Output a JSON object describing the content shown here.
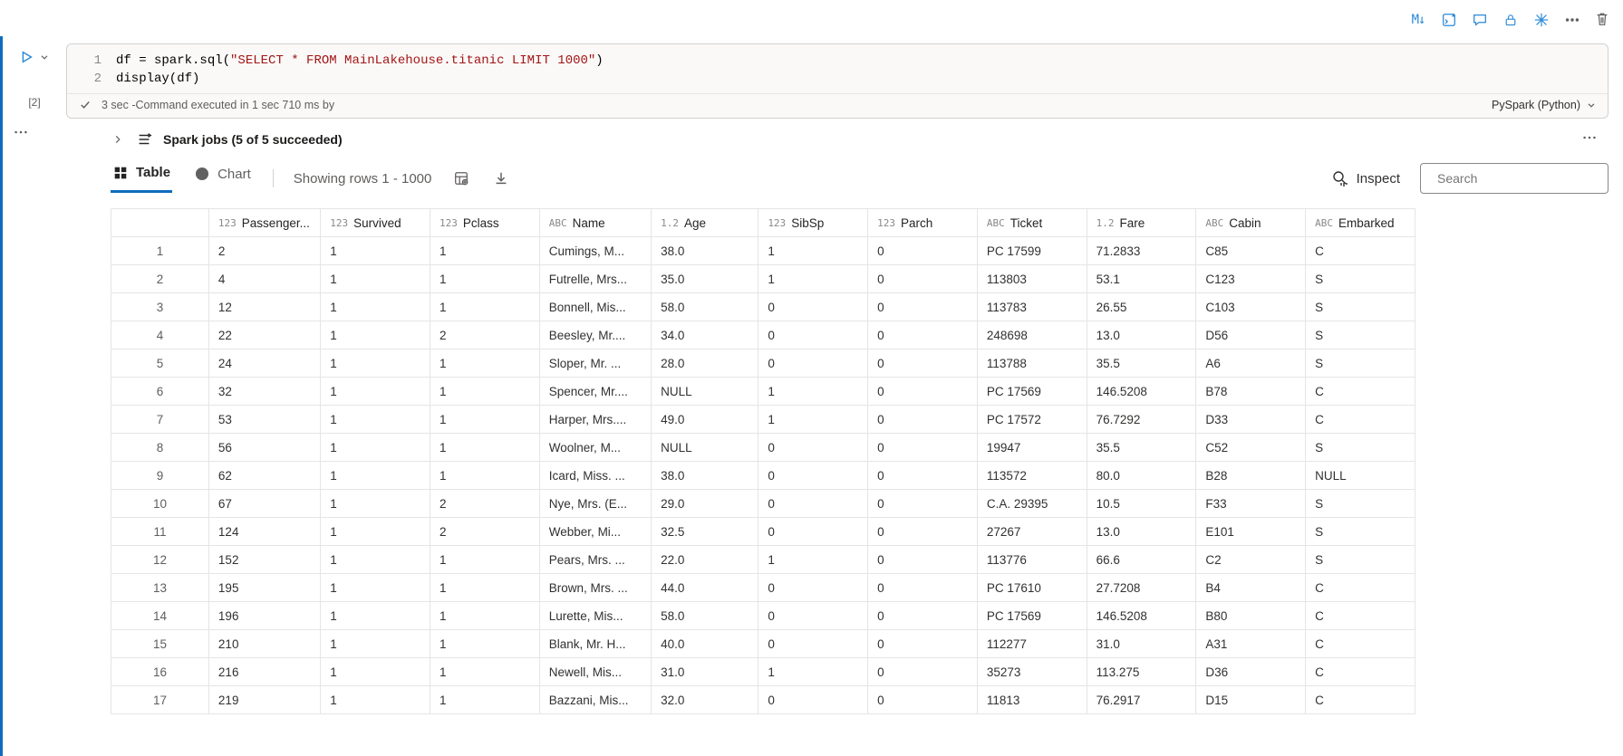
{
  "toolbar": {
    "md_label": "M↓"
  },
  "cell": {
    "play_aria": "Run cell",
    "exec_label": "[2]",
    "code": {
      "line1_prefix": "df = spark.sql(",
      "line1_string": "\"SELECT * FROM MainLakehouse.titanic LIMIT 1000\"",
      "line1_suffix": ")",
      "line2": "display(df)"
    },
    "status_text": "3 sec -Command executed in 1 sec 710 ms by",
    "lang_label": "PySpark (Python)"
  },
  "output": {
    "spark_title": "Spark jobs (5 of 5 succeeded)",
    "tabs": {
      "table": "Table",
      "chart": "Chart"
    },
    "rows_showing": "Showing rows 1 - 1000",
    "inspect_label": "Inspect",
    "search_placeholder": "Search"
  },
  "table": {
    "columns": [
      {
        "type": "123",
        "label": "Passenger..."
      },
      {
        "type": "123",
        "label": "Survived"
      },
      {
        "type": "123",
        "label": "Pclass"
      },
      {
        "type": "ABC",
        "label": "Name"
      },
      {
        "type": "1.2",
        "label": "Age"
      },
      {
        "type": "123",
        "label": "SibSp"
      },
      {
        "type": "123",
        "label": "Parch"
      },
      {
        "type": "ABC",
        "label": "Ticket"
      },
      {
        "type": "1.2",
        "label": "Fare"
      },
      {
        "type": "ABC",
        "label": "Cabin"
      },
      {
        "type": "ABC",
        "label": "Embarked"
      }
    ],
    "rows": [
      {
        "n": "1",
        "pid": "2",
        "surv": "1",
        "pcl": "1",
        "name": "Cumings, M...",
        "age": "38.0",
        "sib": "1",
        "par": "0",
        "tic": "PC 17599",
        "fare": "71.2833",
        "cab": "C85",
        "emb": "C"
      },
      {
        "n": "2",
        "pid": "4",
        "surv": "1",
        "pcl": "1",
        "name": "Futrelle, Mrs...",
        "age": "35.0",
        "sib": "1",
        "par": "0",
        "tic": "113803",
        "fare": "53.1",
        "cab": "C123",
        "emb": "S"
      },
      {
        "n": "3",
        "pid": "12",
        "surv": "1",
        "pcl": "1",
        "name": "Bonnell, Mis...",
        "age": "58.0",
        "sib": "0",
        "par": "0",
        "tic": "113783",
        "fare": "26.55",
        "cab": "C103",
        "emb": "S"
      },
      {
        "n": "4",
        "pid": "22",
        "surv": "1",
        "pcl": "2",
        "name": "Beesley, Mr....",
        "age": "34.0",
        "sib": "0",
        "par": "0",
        "tic": "248698",
        "fare": "13.0",
        "cab": "D56",
        "emb": "S"
      },
      {
        "n": "5",
        "pid": "24",
        "surv": "1",
        "pcl": "1",
        "name": "Sloper, Mr. ...",
        "age": "28.0",
        "sib": "0",
        "par": "0",
        "tic": "113788",
        "fare": "35.5",
        "cab": "A6",
        "emb": "S"
      },
      {
        "n": "6",
        "pid": "32",
        "surv": "1",
        "pcl": "1",
        "name": "Spencer, Mr....",
        "age": "NULL",
        "sib": "1",
        "par": "0",
        "tic": "PC 17569",
        "fare": "146.5208",
        "cab": "B78",
        "emb": "C"
      },
      {
        "n": "7",
        "pid": "53",
        "surv": "1",
        "pcl": "1",
        "name": "Harper, Mrs....",
        "age": "49.0",
        "sib": "1",
        "par": "0",
        "tic": "PC 17572",
        "fare": "76.7292",
        "cab": "D33",
        "emb": "C"
      },
      {
        "n": "8",
        "pid": "56",
        "surv": "1",
        "pcl": "1",
        "name": "Woolner, M...",
        "age": "NULL",
        "sib": "0",
        "par": "0",
        "tic": "19947",
        "fare": "35.5",
        "cab": "C52",
        "emb": "S"
      },
      {
        "n": "9",
        "pid": "62",
        "surv": "1",
        "pcl": "1",
        "name": "Icard, Miss. ...",
        "age": "38.0",
        "sib": "0",
        "par": "0",
        "tic": "113572",
        "fare": "80.0",
        "cab": "B28",
        "emb": "NULL"
      },
      {
        "n": "10",
        "pid": "67",
        "surv": "1",
        "pcl": "2",
        "name": "Nye, Mrs. (E...",
        "age": "29.0",
        "sib": "0",
        "par": "0",
        "tic": "C.A. 29395",
        "fare": "10.5",
        "cab": "F33",
        "emb": "S"
      },
      {
        "n": "11",
        "pid": "124",
        "surv": "1",
        "pcl": "2",
        "name": "Webber, Mi...",
        "age": "32.5",
        "sib": "0",
        "par": "0",
        "tic": "27267",
        "fare": "13.0",
        "cab": "E101",
        "emb": "S"
      },
      {
        "n": "12",
        "pid": "152",
        "surv": "1",
        "pcl": "1",
        "name": "Pears, Mrs. ...",
        "age": "22.0",
        "sib": "1",
        "par": "0",
        "tic": "113776",
        "fare": "66.6",
        "cab": "C2",
        "emb": "S"
      },
      {
        "n": "13",
        "pid": "195",
        "surv": "1",
        "pcl": "1",
        "name": "Brown, Mrs. ...",
        "age": "44.0",
        "sib": "0",
        "par": "0",
        "tic": "PC 17610",
        "fare": "27.7208",
        "cab": "B4",
        "emb": "C"
      },
      {
        "n": "14",
        "pid": "196",
        "surv": "1",
        "pcl": "1",
        "name": "Lurette, Mis...",
        "age": "58.0",
        "sib": "0",
        "par": "0",
        "tic": "PC 17569",
        "fare": "146.5208",
        "cab": "B80",
        "emb": "C"
      },
      {
        "n": "15",
        "pid": "210",
        "surv": "1",
        "pcl": "1",
        "name": "Blank, Mr. H...",
        "age": "40.0",
        "sib": "0",
        "par": "0",
        "tic": "112277",
        "fare": "31.0",
        "cab": "A31",
        "emb": "C"
      },
      {
        "n": "16",
        "pid": "216",
        "surv": "1",
        "pcl": "1",
        "name": "Newell, Mis...",
        "age": "31.0",
        "sib": "1",
        "par": "0",
        "tic": "35273",
        "fare": "113.275",
        "cab": "D36",
        "emb": "C"
      },
      {
        "n": "17",
        "pid": "219",
        "surv": "1",
        "pcl": "1",
        "name": "Bazzani, Mis...",
        "age": "32.0",
        "sib": "0",
        "par": "0",
        "tic": "11813",
        "fare": "76.2917",
        "cab": "D15",
        "emb": "C"
      }
    ]
  }
}
